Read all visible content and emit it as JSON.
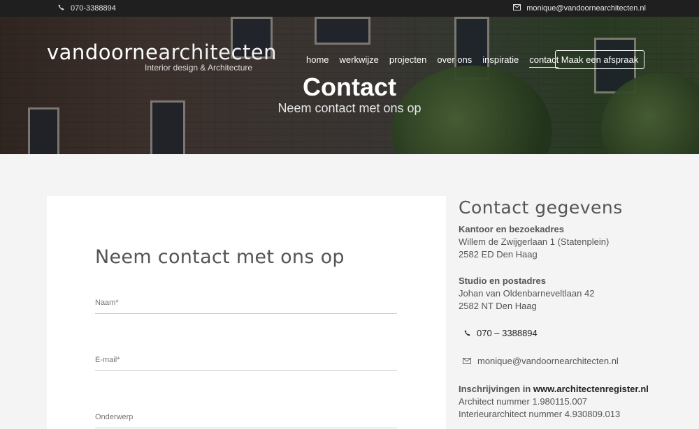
{
  "topbar": {
    "phone": "070-3388894",
    "email": "monique@vandoornearchitecten.nl"
  },
  "brand": {
    "name_bold": "vandoorne",
    "name_light": "architecten",
    "tagline": "Interior design & Architecture"
  },
  "nav": {
    "items": [
      "home",
      "werkwijze",
      "projecten",
      "over ons",
      "inspiratie",
      "contact"
    ],
    "active": "contact",
    "cta": "Maak een afspraak"
  },
  "hero": {
    "title": "Contact",
    "subtitle": "Neem contact met ons op"
  },
  "form": {
    "title": "Neem contact met ons op",
    "fields": {
      "name": "Naam*",
      "email": "E-mail*",
      "subject": "Onderwerp"
    }
  },
  "contact": {
    "title": "Contact gegevens",
    "office_label": "Kantoor en bezoekadres",
    "office_line1": "Willem de Zwijgerlaan 1 (Statenplein)",
    "office_line2": "2582 ED Den Haag",
    "studio_label": "Studio en postadres",
    "studio_line1": "Johan van Oldenbarneveltlaan 42",
    "studio_line2": "2582 NT Den Haag",
    "phone": "070 – 3388894",
    "email": "monique@vandoornearchitecten.nl",
    "register_label": "Inschrijvingen in",
    "register_link": "www.architectenregister.nl",
    "architect_nr": "Architect nummer 1.980115.007",
    "interior_nr": "Interieurarchitect nummer 4.930809.013"
  }
}
